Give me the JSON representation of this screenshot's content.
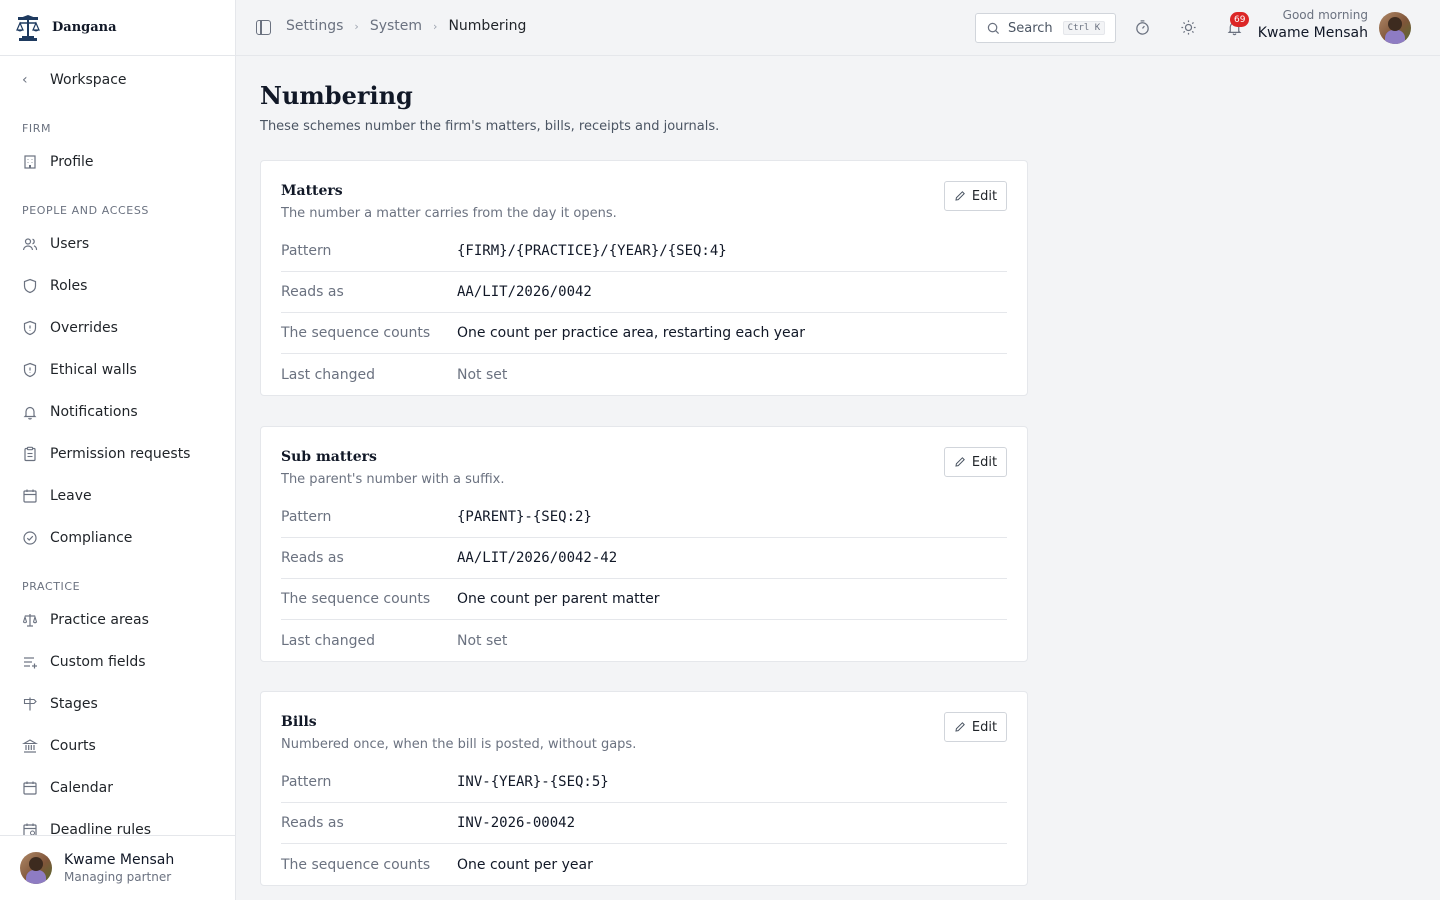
{
  "app": {
    "name": "Dangana"
  },
  "sidebar": {
    "back_label": "Workspace",
    "sections": [
      {
        "heading": "FIRM",
        "items": [
          {
            "label": "Profile",
            "icon": "building-icon"
          }
        ]
      },
      {
        "heading": "PEOPLE AND ACCESS",
        "items": [
          {
            "label": "Users",
            "icon": "users-icon"
          },
          {
            "label": "Roles",
            "icon": "shield-icon"
          },
          {
            "label": "Overrides",
            "icon": "shield-alert-icon"
          },
          {
            "label": "Ethical walls",
            "icon": "shield-alert-icon"
          },
          {
            "label": "Notifications",
            "icon": "bell-icon"
          },
          {
            "label": "Permission requests",
            "icon": "clipboard-icon"
          },
          {
            "label": "Leave",
            "icon": "calendar-icon"
          },
          {
            "label": "Compliance",
            "icon": "check-circle-icon"
          }
        ]
      },
      {
        "heading": "PRACTICE",
        "items": [
          {
            "label": "Practice areas",
            "icon": "scale-icon"
          },
          {
            "label": "Custom fields",
            "icon": "list-plus-icon"
          },
          {
            "label": "Stages",
            "icon": "signpost-icon"
          },
          {
            "label": "Courts",
            "icon": "landmark-icon"
          },
          {
            "label": "Calendar",
            "icon": "calendar-icon"
          },
          {
            "label": "Deadline rules",
            "icon": "calendar-clock-icon"
          }
        ]
      }
    ],
    "user": {
      "name": "Kwame Mensah",
      "role": "Managing partner"
    }
  },
  "topbar": {
    "breadcrumbs": [
      "Settings",
      "System",
      "Numbering"
    ],
    "search": {
      "label": "Search",
      "shortcut": "Ctrl K"
    },
    "notifications_count": "69",
    "greeting": "Good morning",
    "user_name": "Kwame Mensah"
  },
  "page": {
    "title": "Numbering",
    "subtitle": "These schemes number the firm's matters, bills, receipts and journals.",
    "edit_label": "Edit",
    "cards": [
      {
        "title": "Matters",
        "description": "The number a matter carries from the day it opens.",
        "rows": [
          {
            "label": "Pattern",
            "value": "{FIRM}/{PRACTICE}/{YEAR}/{SEQ:4}"
          },
          {
            "label": "Reads as",
            "value": "AA/LIT/2026/0042"
          },
          {
            "label": "The sequence counts",
            "value": "One count per practice area, restarting each year"
          },
          {
            "label": "Last changed",
            "value": "Not set"
          }
        ]
      },
      {
        "title": "Sub matters",
        "description": "The parent's number with a suffix.",
        "rows": [
          {
            "label": "Pattern",
            "value": "{PARENT}-{SEQ:2}"
          },
          {
            "label": "Reads as",
            "value": "AA/LIT/2026/0042-42"
          },
          {
            "label": "The sequence counts",
            "value": "One count per parent matter"
          },
          {
            "label": "Last changed",
            "value": "Not set"
          }
        ]
      },
      {
        "title": "Bills",
        "description": "Numbered once, when the bill is posted, without gaps.",
        "rows": [
          {
            "label": "Pattern",
            "value": "INV-{YEAR}-{SEQ:5}"
          },
          {
            "label": "Reads as",
            "value": "INV-2026-00042"
          },
          {
            "label": "The sequence counts",
            "value": "One count per year"
          }
        ]
      }
    ]
  },
  "colors": {
    "badge": "#dc2626",
    "border": "#e5e7eb",
    "muted": "#6b7280"
  }
}
